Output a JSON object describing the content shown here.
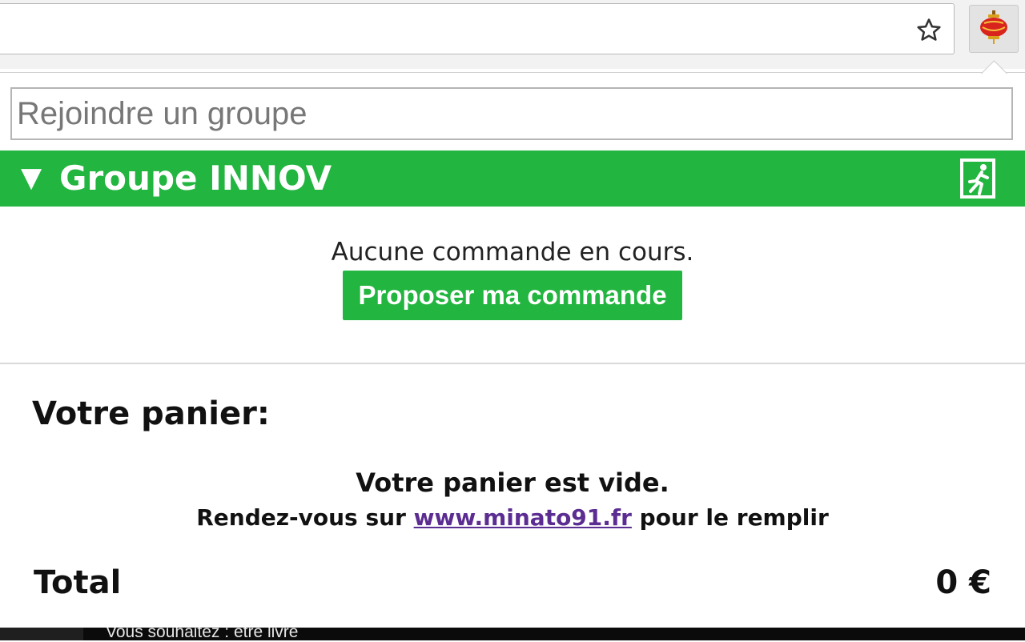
{
  "toolbar": {
    "bookmark_icon": "star-icon",
    "extension_icon": "lantern-icon"
  },
  "popup": {
    "join_input": {
      "placeholder": "Rejoindre un groupe",
      "value": ""
    },
    "group": {
      "toggle_glyph": "▼",
      "name": "Groupe INNOV",
      "leave_icon": "exit-icon",
      "color": "#22b53f"
    },
    "orders": {
      "status": "Aucune commande en cours.",
      "propose_label": "Proposer ma commande"
    },
    "cart": {
      "title": "Votre panier:",
      "empty_text": "Votre panier est vide.",
      "hint_prefix": "Rendez-vous sur ",
      "hint_link": "www.minato91.fr",
      "hint_suffix": " pour le remplir",
      "total_label": "Total",
      "total_value": "0 €"
    }
  },
  "background_page": {
    "partial_text": "Vous souhaitez : être livré"
  }
}
